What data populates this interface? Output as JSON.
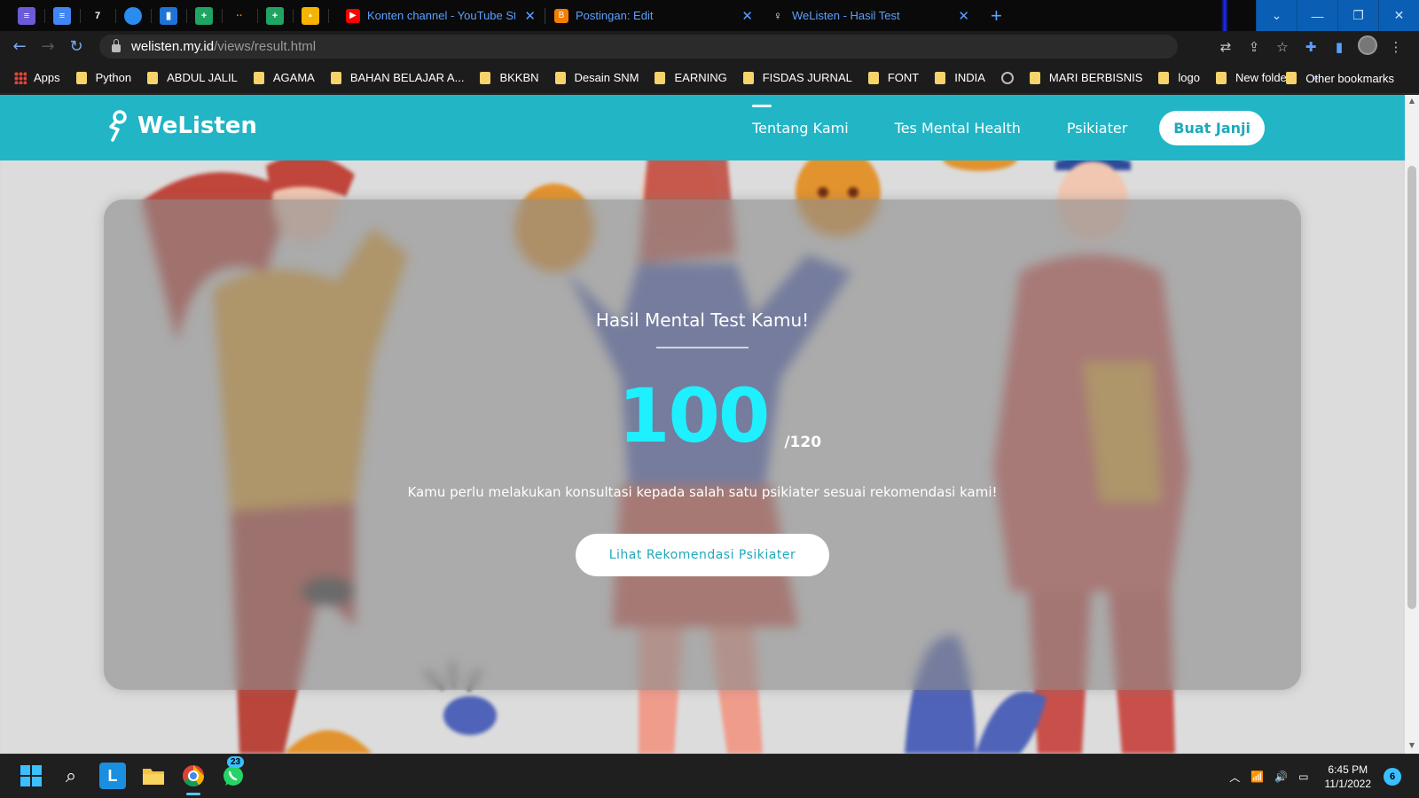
{
  "browser": {
    "pinned_tabs": [
      {
        "icon": "checklist-icon",
        "color": "#6b5bd6"
      },
      {
        "icon": "docs-icon",
        "color": "#4285f4"
      },
      {
        "icon": "seven-icon",
        "color": "#0a0a0a",
        "glyph": "7"
      },
      {
        "icon": "cloud-icon",
        "color": "#2a8cf0"
      },
      {
        "icon": "trello-icon",
        "color": "#1e73d6"
      },
      {
        "icon": "sheets-icon",
        "color": "#1fa463"
      },
      {
        "icon": "dots-icon",
        "color": "#0a0a0a"
      },
      {
        "icon": "sheets-icon",
        "color": "#1fa463"
      },
      {
        "icon": "keep-icon",
        "color": "#f6b400"
      }
    ],
    "tabs": [
      {
        "title": "Konten channel - YouTube Studio",
        "icon": "youtube-icon",
        "color": "#ff0000"
      },
      {
        "title": "Postingan: Edit",
        "icon": "blogger-icon",
        "color": "#f57d00"
      },
      {
        "title": "WeListen - Hasil Test",
        "icon": "welisten-icon",
        "color": "#ffffff"
      }
    ],
    "new_tab": "+",
    "url_host": "welisten.my.id",
    "url_path": "/views/result.html",
    "bookmarks": [
      "Apps",
      "Python",
      "ABDUL JALIL",
      "AGAMA",
      "BAHAN BELAJAR A...",
      "BKKBN",
      "Desain SNM",
      "EARNING",
      "FISDAS JURNAL",
      "FONT",
      "INDIA",
      "MARI BERBISNIS",
      "logo",
      "New folder"
    ],
    "bookmarks_more": "»",
    "other_bookmarks": "Other bookmarks"
  },
  "site": {
    "brand": "WeListen",
    "nav": {
      "about": "Tentang Kami",
      "test": "Tes Mental Health",
      "psychiatrist": "Psikiater",
      "appointment": "Buat Janji"
    },
    "accent": "#21b5c6",
    "score_color": "#1ef0ff"
  },
  "result": {
    "title": "Hasil Mental Test Kamu!",
    "score": "100",
    "max": "/120",
    "score_value": 100,
    "score_max": 120,
    "message": "Kamu perlu melakukan konsultasi kepada salah satu psikiater sesuai rekomendasi kami!",
    "button": "Lihat Rekomendasi Psikiater"
  },
  "taskbar": {
    "whatsapp_badge": "23",
    "time": "6:45 PM",
    "date": "11/1/2022",
    "notifications": "6"
  }
}
